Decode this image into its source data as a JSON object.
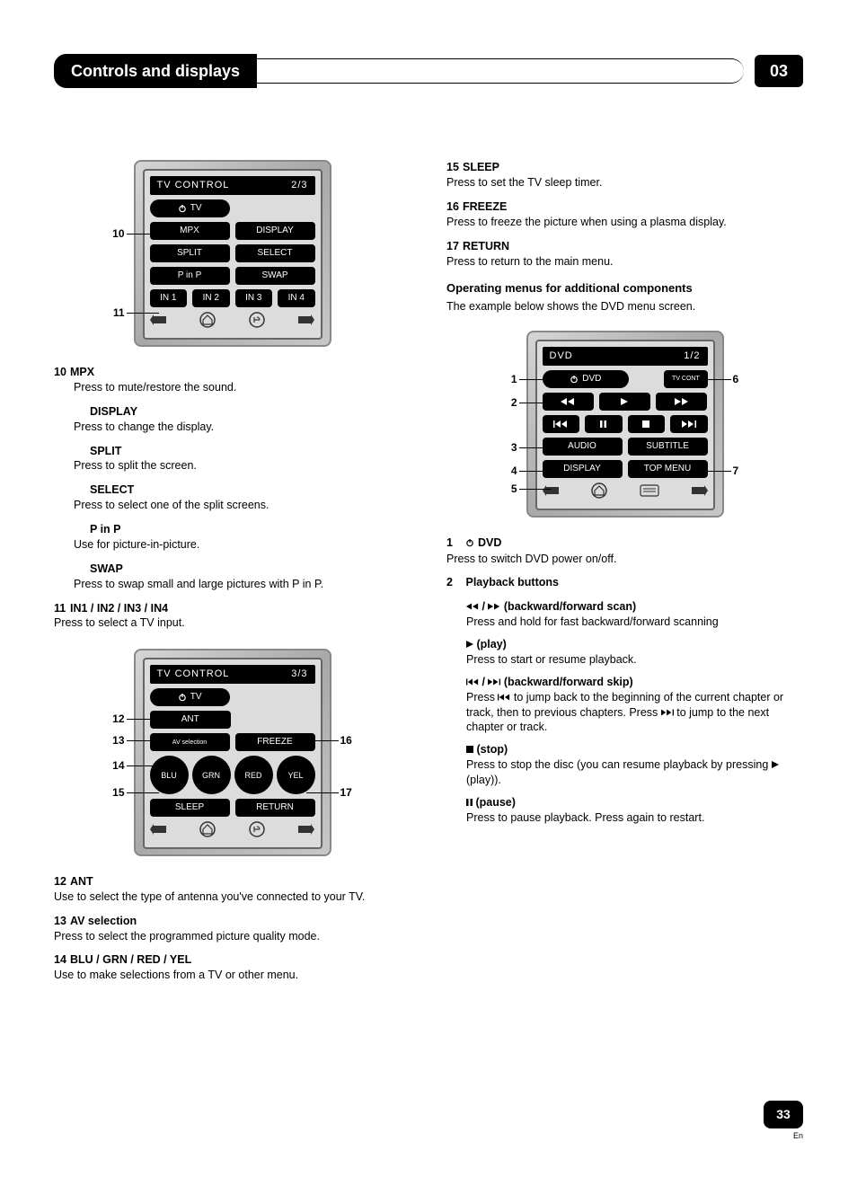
{
  "header": {
    "title": "Controls and displays",
    "chapter": "03"
  },
  "remote1": {
    "title": "TV  CONTROL",
    "page": "2/3",
    "power_label": "TV",
    "row1": [
      "MPX",
      "DISPLAY"
    ],
    "row2": [
      "SPLIT",
      "SELECT"
    ],
    "row3": [
      "P in P",
      "SWAP"
    ],
    "row4": [
      "IN 1",
      "IN 2",
      "IN 3",
      "IN 4"
    ],
    "callouts": {
      "c10": "10",
      "c11": "11"
    }
  },
  "remote2": {
    "title": "TV  CONTROL",
    "page": "3/3",
    "power_label": "TV",
    "ant": "ANT",
    "row2": [
      "AV selection",
      "FREEZE"
    ],
    "colors": [
      "BLU",
      "GRN",
      "RED",
      "YEL"
    ],
    "row4": [
      "SLEEP",
      "RETURN"
    ],
    "callouts": {
      "c12": "12",
      "c13": "13",
      "c14": "14",
      "c15": "15",
      "c16": "16",
      "c17": "17"
    }
  },
  "remote3": {
    "title": "DVD",
    "page": "1/2",
    "power_label": "DVD",
    "tvcont": "TV CONT",
    "row3": [
      "AUDIO",
      "SUBTITLE"
    ],
    "row4": [
      "DISPLAY",
      "TOP MENU"
    ],
    "callouts": {
      "c1": "1",
      "c2": "2",
      "c3": "3",
      "c4": "4",
      "c5": "5",
      "c6": "6",
      "c7": "7"
    }
  },
  "desc_left1": [
    {
      "num": "10",
      "title": "MPX",
      "body": "Press to mute/restore the sound."
    },
    {
      "num": "",
      "title": "DISPLAY",
      "body": "Press to change the display."
    },
    {
      "num": "",
      "title": "SPLIT",
      "body": "Press to split the screen."
    },
    {
      "num": "",
      "title": "SELECT",
      "body": "Press to select one of the split screens."
    },
    {
      "num": "",
      "title": "P in P",
      "body": "Use for picture-in-picture."
    },
    {
      "num": "",
      "title": "SWAP",
      "body": "Press to swap small and large pictures with P in P."
    },
    {
      "num": "11",
      "title": "IN1 / IN2 / IN3 / IN4",
      "body": "Press to select a TV input."
    }
  ],
  "desc_left2": [
    {
      "num": "12",
      "title": "ANT",
      "body": "Use to select the type of antenna you've connected to your TV."
    },
    {
      "num": "13",
      "title": "AV selection",
      "body": "Press to select the programmed picture quality mode."
    },
    {
      "num": "14",
      "title": "BLU / GRN / RED / YEL",
      "body": "Use to make selections from a TV or other menu."
    }
  ],
  "desc_right_top": [
    {
      "num": "15",
      "title": "SLEEP",
      "body": "Press to set the TV sleep timer."
    },
    {
      "num": "16",
      "title": "FREEZE",
      "body": "Press to freeze the picture when using a plasma display."
    },
    {
      "num": "17",
      "title": "RETURN",
      "body": "Press to return to the main menu."
    }
  ],
  "operating": {
    "heading": "Operating menus for additional components",
    "sub": "The example below shows the DVD menu screen."
  },
  "dvd_desc": {
    "item1_num": "1",
    "item1_title": "DVD",
    "item1_body": "Press to switch DVD power on/off.",
    "item2_num": "2",
    "item2_title": "Playback buttons",
    "scan_title": " (backward/forward scan)",
    "scan_body": "Press and hold for fast backward/forward scanning",
    "play_title": " (play)",
    "play_body": "Press to start or resume playback.",
    "skip_title": " (backward/forward skip)",
    "skip_body1": "Press ",
    "skip_body2": " to jump back to the beginning of the current chapter or track, then to previous chapters. Press ",
    "skip_body3": " to jump to the next chapter or track.",
    "stop_title": " (stop)",
    "stop_body1": "Press to stop the disc (you can resume playback by pressing ",
    "stop_body2": " (play)).",
    "pause_title": " (pause)",
    "pause_body": "Press to pause playback. Press again to restart."
  },
  "footer": {
    "page": "33",
    "lang": "En"
  }
}
